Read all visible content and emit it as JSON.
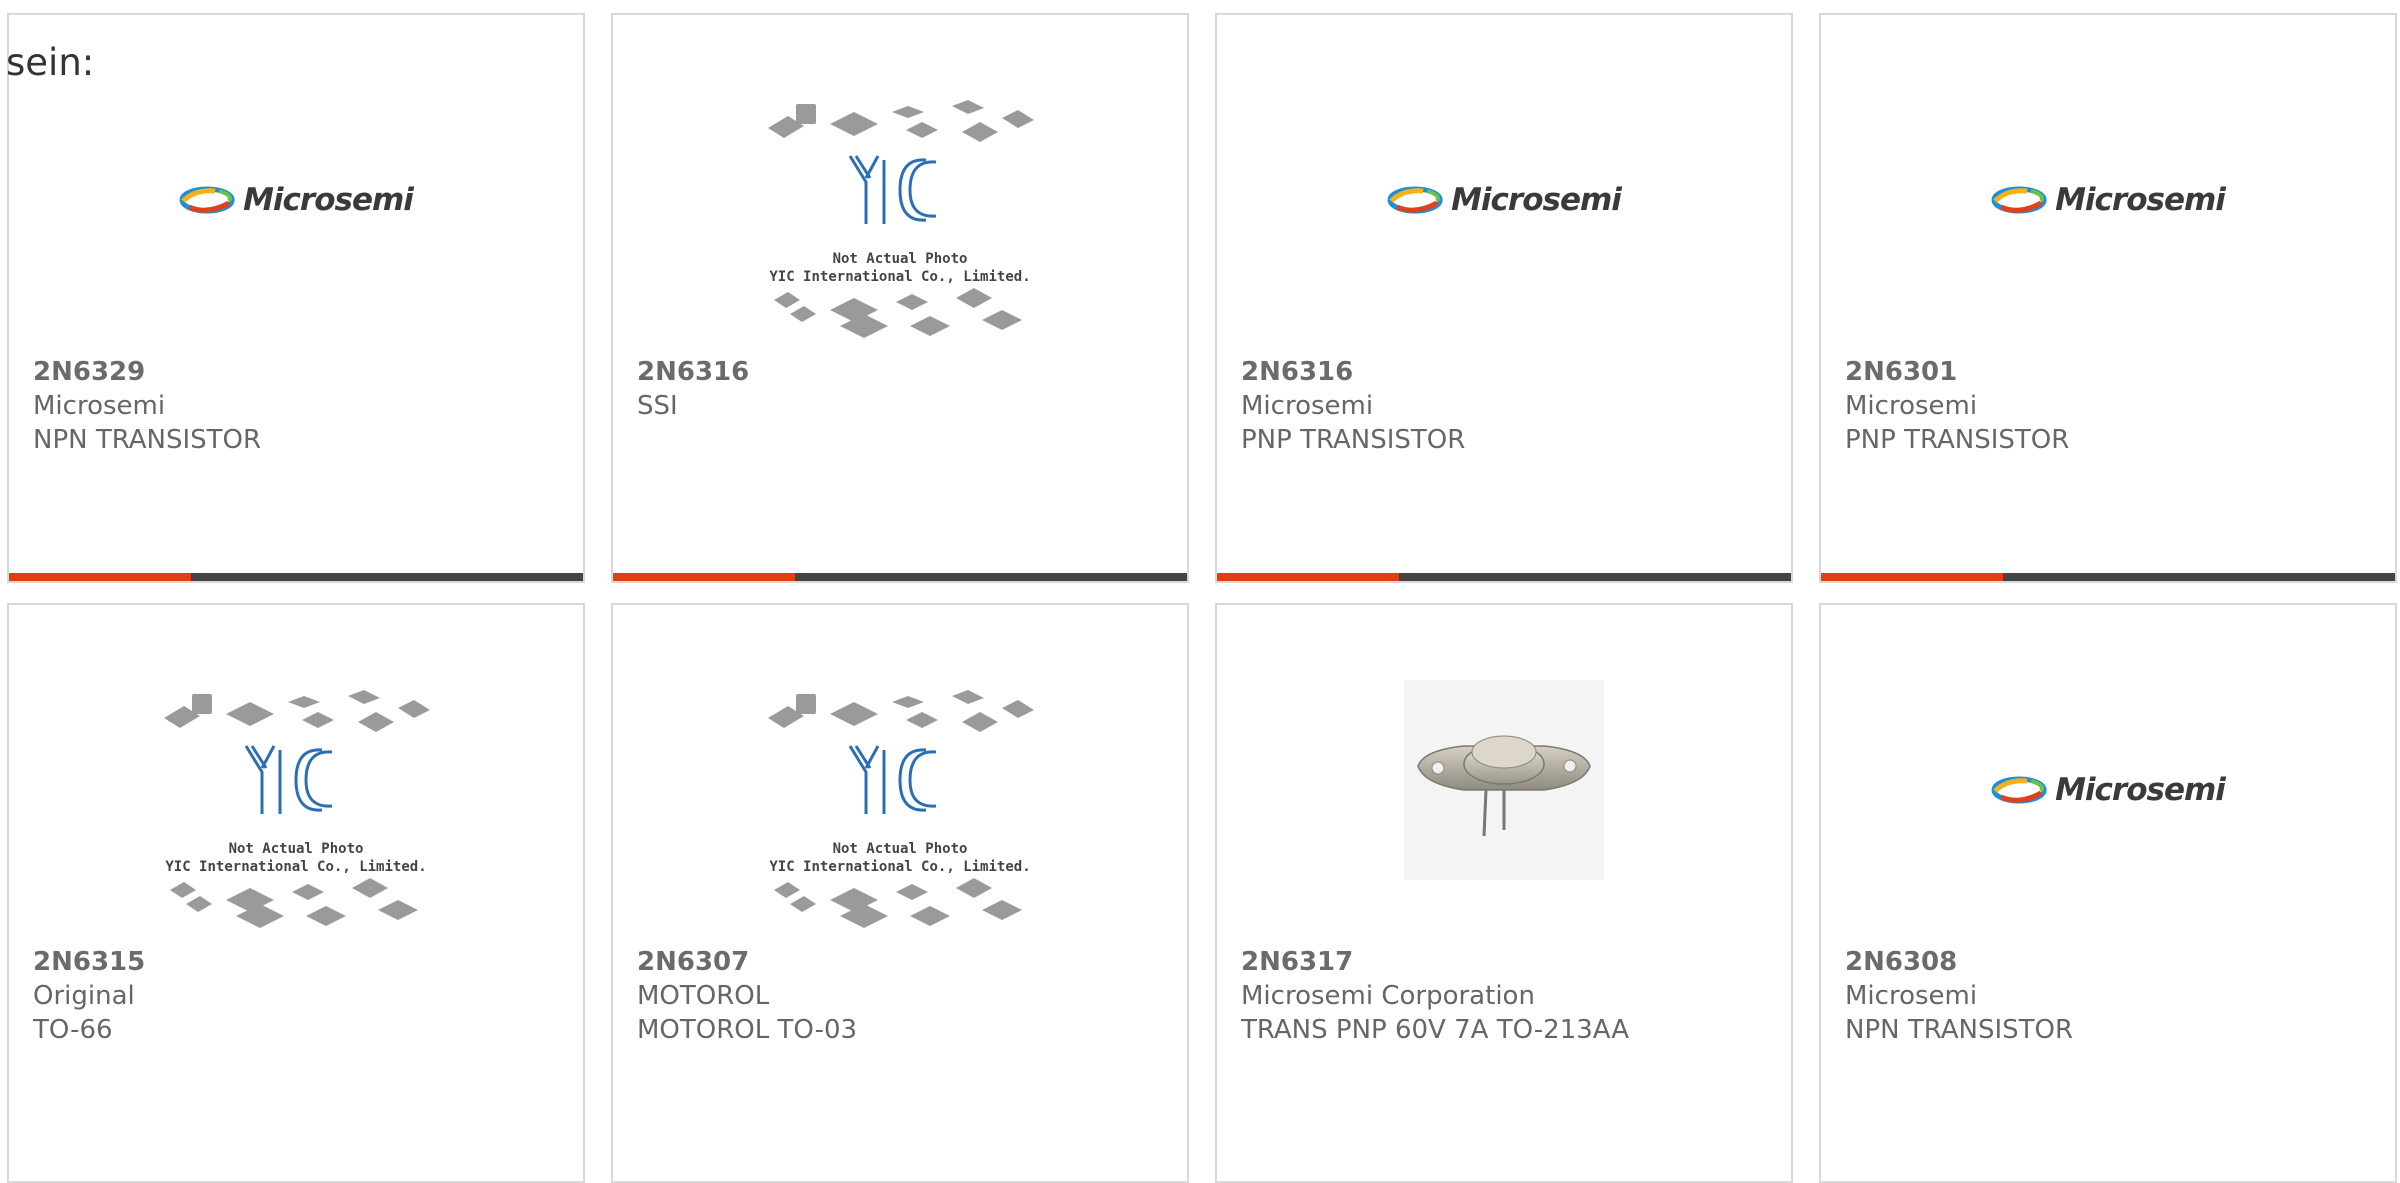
{
  "intro_text": "sein:",
  "cards": [
    {
      "part": "2N6329",
      "maker": "Microsemi",
      "desc": "NPN TRANSISTOR",
      "image": "microsemi-logo",
      "logo_text": "Microsemi"
    },
    {
      "part": "2N6316",
      "maker": "SSI",
      "desc": "",
      "image": "yic-placeholder",
      "caption_1": "Not Actual Photo",
      "caption_2": "YIC International Co., Limited.",
      "logo_text": "YIC"
    },
    {
      "part": "2N6316",
      "maker": "Microsemi",
      "desc": "PNP TRANSISTOR",
      "image": "microsemi-logo",
      "logo_text": "Microsemi"
    },
    {
      "part": "2N6301",
      "maker": "Microsemi",
      "desc": "PNP TRANSISTOR",
      "image": "microsemi-logo",
      "logo_text": "Microsemi"
    },
    {
      "part": "2N6315",
      "maker": "Original",
      "desc": "TO-66",
      "image": "yic-placeholder",
      "caption_1": "Not Actual Photo",
      "caption_2": "YIC International Co., Limited.",
      "logo_text": "YIC"
    },
    {
      "part": "2N6307",
      "maker": "MOTOROL",
      "desc": "MOTOROL TO-03",
      "image": "yic-placeholder",
      "caption_1": "Not Actual Photo",
      "caption_2": "YIC International Co., Limited.",
      "logo_text": "YIC"
    },
    {
      "part": "2N6317",
      "maker": "Microsemi Corporation",
      "desc": "TRANS PNP 60V 7A TO-213AA",
      "image": "transistor-photo"
    },
    {
      "part": "2N6308",
      "maker": "Microsemi",
      "desc": "NPN TRANSISTOR",
      "image": "microsemi-logo",
      "logo_text": "Microsemi"
    }
  ],
  "colors": {
    "accent": "#e0400f",
    "bar": "#444444",
    "border": "#d8d8d8",
    "text": "#666666"
  }
}
